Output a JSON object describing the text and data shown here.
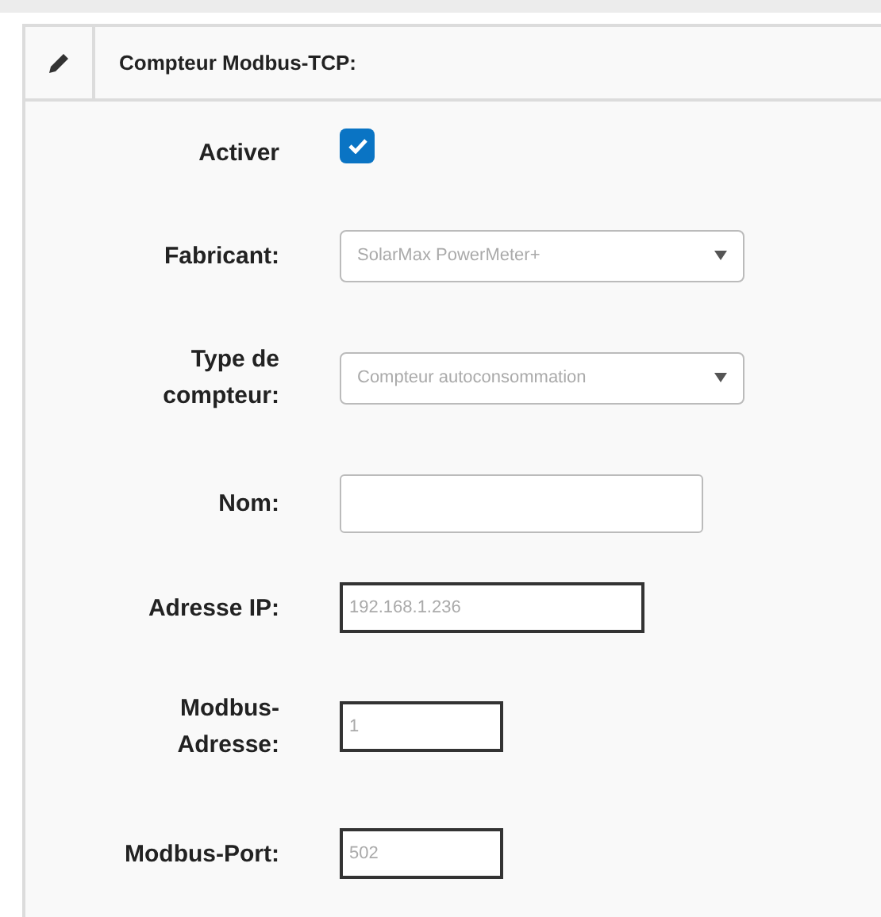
{
  "panel": {
    "title": "Compteur Modbus-TCP:"
  },
  "fields": [
    {
      "kind": "checkbox",
      "label": "Activer",
      "checked": true
    },
    {
      "kind": "select",
      "label": "Fabricant:",
      "value": "SolarMax PowerMeter+"
    },
    {
      "kind": "select",
      "label": "Type de compteur:",
      "value": "Compteur autoconsommation"
    },
    {
      "kind": "text",
      "label": "Nom:"
    },
    {
      "kind": "wideinput",
      "label": "Adresse IP:",
      "value": "192.168.1.236"
    },
    {
      "kind": "shortinput",
      "label": "Modbus-Adresse:",
      "value": "1"
    },
    {
      "kind": "shortinput",
      "label": "Modbus-Port:",
      "value": "502"
    }
  ]
}
